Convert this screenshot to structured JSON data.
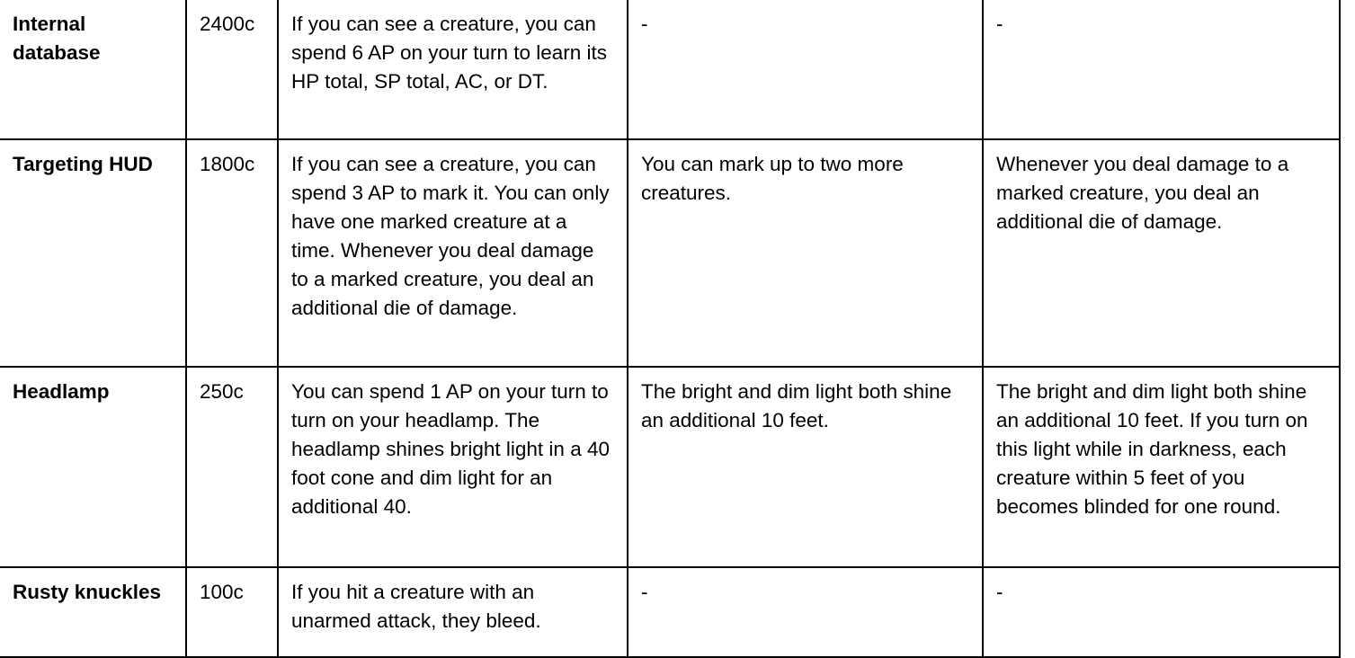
{
  "table": {
    "rows": [
      {
        "name": "Internal database",
        "cost": "2400c",
        "base": "If you can see a creature, you can spend 6 AP on your turn to learn its HP total, SP total, AC, or DT.",
        "upgrade1": "-",
        "upgrade2": "-"
      },
      {
        "name": "Targeting HUD",
        "cost": "1800c",
        "base": "If you can see a creature, you can spend 3 AP to mark it. You can only have one marked creature at a time. Whenever you deal damage to a marked creature, you deal an additional die of damage.",
        "upgrade1": "You can mark up to two more creatures.",
        "upgrade2": "Whenever you deal damage to a marked creature, you deal an additional die of damage."
      },
      {
        "name": "Headlamp",
        "cost": "250c",
        "base": "You can spend 1 AP on your turn to turn on your headlamp. The headlamp shines bright light in a 40 foot cone and dim light for an additional 40.",
        "upgrade1": "The bright and dim light both shine an additional 10 feet.",
        "upgrade2": "The bright and dim light both shine an additional 10 feet. If you turn on this light while in darkness, each creature within 5 feet of you becomes blinded for one round."
      },
      {
        "name": "Rusty knuckles",
        "cost": "100c",
        "base": "If you hit a creature with an unarmed attack, they bleed.",
        "upgrade1": "-",
        "upgrade2": "-"
      }
    ]
  }
}
